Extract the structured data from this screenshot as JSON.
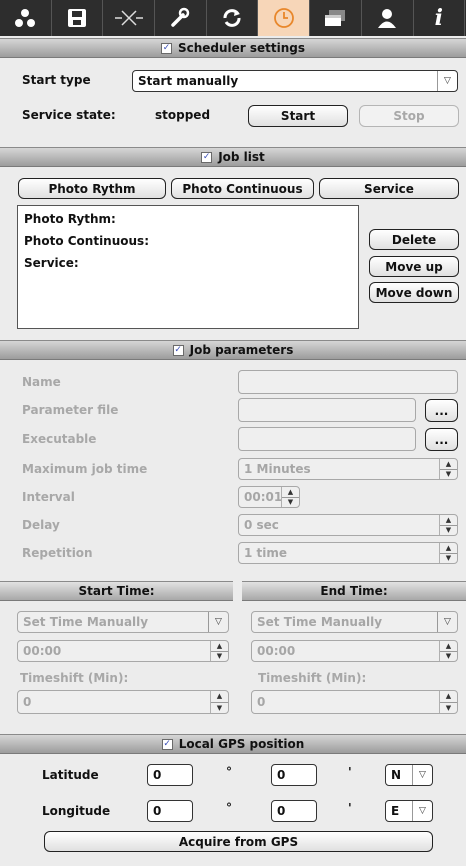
{
  "toolbar": {
    "icons": [
      "connection-icon",
      "save-icon",
      "signal-icon",
      "wrench-icon",
      "refresh-icon",
      "clock-icon",
      "window-icon",
      "user-icon",
      "info-icon"
    ],
    "active_index": 5,
    "accent": "#f7d6b8"
  },
  "scheduler": {
    "title": "Scheduler settings",
    "start_type_label": "Start type",
    "start_type_value": "Start manually",
    "service_state_label": "Service state:",
    "service_state_value": "stopped",
    "start_btn": "Start",
    "stop_btn": "Stop"
  },
  "job_list": {
    "title": "Job list",
    "buttons": [
      "Photo Rythm",
      "Photo Continuous",
      "Service"
    ],
    "items": [
      "Photo Rythm:",
      "Photo Continuous:",
      "Service:"
    ],
    "delete_btn": "Delete",
    "move_up_btn": "Move up",
    "move_down_btn": "Move down"
  },
  "job_params": {
    "title": "Job parameters",
    "name_label": "Name",
    "param_file_label": "Parameter file",
    "executable_label": "Executable",
    "browse_btn": "...",
    "max_time_label": "Maximum job time",
    "max_time_value": "1 Minutes",
    "interval_label": "Interval",
    "interval_value": "00:01",
    "delay_label": "Delay",
    "delay_value": "0 sec",
    "repetition_label": "Repetition",
    "repetition_value": "1 time"
  },
  "start_time": {
    "title": "Start Time:",
    "mode": "Set Time Manually",
    "time": "00:00",
    "timeshift_label": "Timeshift (Min):",
    "timeshift": "0"
  },
  "end_time": {
    "title": "End Time:",
    "mode": "Set Time Manually",
    "time": "00:00",
    "timeshift_label": "Timeshift (Min):",
    "timeshift": "0"
  },
  "gps": {
    "title": "Local GPS position",
    "latitude_label": "Latitude",
    "lat_deg": "0",
    "lat_min": "0",
    "lat_dir": "N",
    "longitude_label": "Longitude",
    "lon_deg": "0",
    "lon_min": "0",
    "lon_dir": "E",
    "deg_sym": "°",
    "min_sym": "'",
    "acquire_btn": "Acquire from GPS"
  },
  "checkbox_mark": "✓"
}
